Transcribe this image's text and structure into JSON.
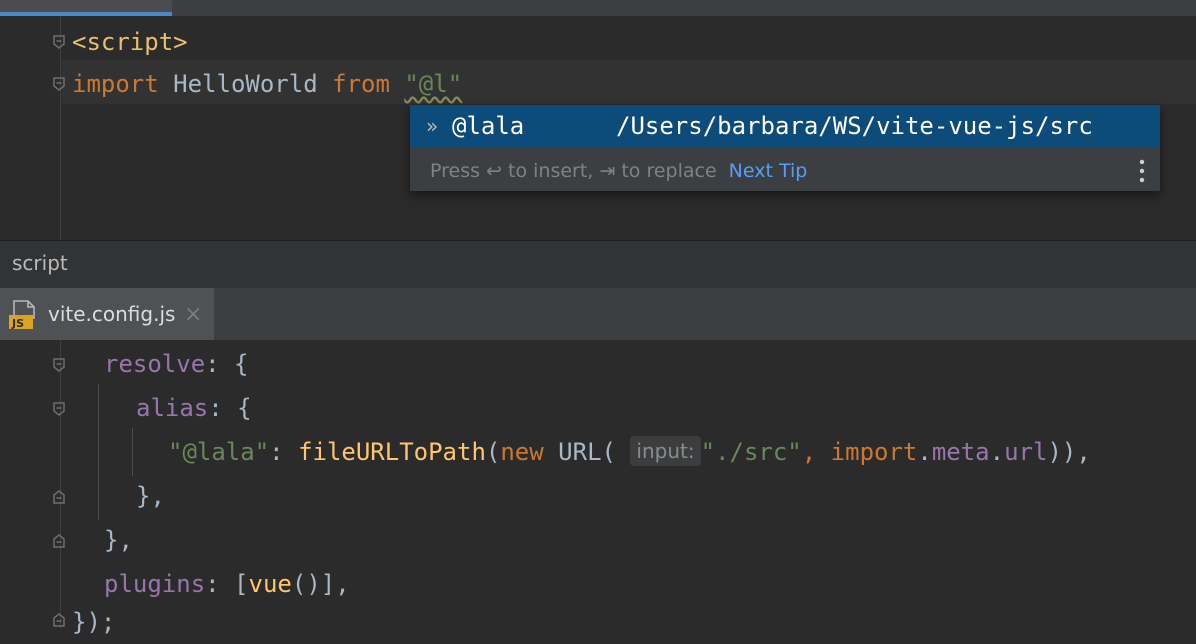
{
  "top_editor": {
    "line1": {
      "tag": "<script>"
    },
    "line2": {
      "kw_import": "import",
      "ident": " HelloWorld ",
      "kw_from": "from",
      "space": " ",
      "str": "\"@l\""
    }
  },
  "completion_popup": {
    "item_name": "@lala",
    "item_path": "/Users/barbara/WS/vite-vue-js/src",
    "hint": "Press ↩ to insert, ⇥ to replace",
    "next_tip": "Next Tip"
  },
  "breadcrumb": "script",
  "bottom_tab": {
    "icon_label": "JS",
    "filename": "vite.config.js",
    "close": "×"
  },
  "bottom_editor": {
    "l1": {
      "prop": "resolve",
      "rest": ": {"
    },
    "l2": {
      "prop": "alias",
      "rest": ": {"
    },
    "l3": {
      "key": "\"@lala\"",
      "colon": ": ",
      "fn": "fileURLToPath",
      "open": "(",
      "kw_new": "new",
      "url": " URL( ",
      "inlay": "input:",
      "str": "\"./src\"",
      "comma": ", ",
      "kw_import": "import",
      "dot1": ".",
      "meta": "meta",
      "dot2": ".",
      "urlprop": "url",
      "close": ")),"
    },
    "l4": {
      "text": "},"
    },
    "l5": {
      "text": "},"
    },
    "l6": {
      "prop": "plugins",
      "rest1": ": [",
      "fn": "vue",
      "rest2": "()],"
    },
    "l7": {
      "text": "});"
    }
  },
  "colors": {
    "keyword": "#cc7832",
    "string": "#6a8759",
    "property": "#9876aa",
    "function": "#ffc66d",
    "selection": "#0d4c7a",
    "link": "#589df6"
  }
}
